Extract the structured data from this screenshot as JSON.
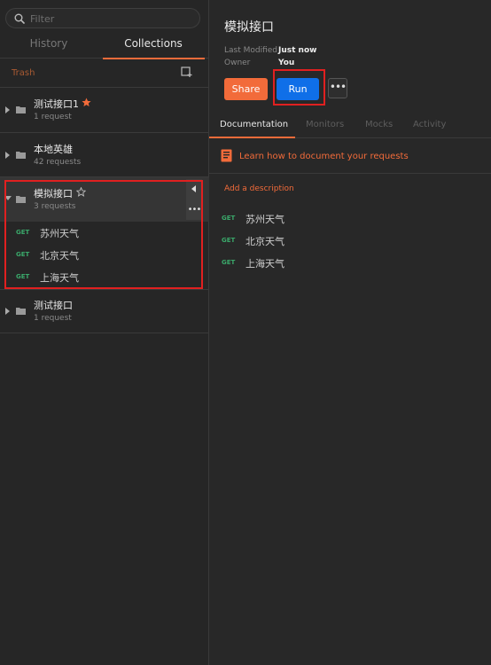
{
  "sidebar": {
    "filter_placeholder": "Filter",
    "tabs": [
      {
        "label": "History"
      },
      {
        "label": "Collections"
      }
    ],
    "trash_label": "Trash",
    "collections": [
      {
        "name": "测试接口1",
        "count": "1 request",
        "starred": true
      },
      {
        "name": "本地英雄",
        "count": "42 requests",
        "starred": false
      },
      {
        "name": "模拟接口",
        "count": "3 requests",
        "starred": false,
        "requests": [
          {
            "method": "GET",
            "name": "苏州天气"
          },
          {
            "method": "GET",
            "name": "北京天气"
          },
          {
            "method": "GET",
            "name": "上海天气"
          }
        ]
      },
      {
        "name": "测试接口",
        "count": "1 request",
        "starred": false
      }
    ]
  },
  "detail": {
    "title": "模拟接口",
    "last_modified_label": "Last Modified",
    "last_modified_value": "Just now",
    "owner_label": "Owner",
    "owner_value": "You",
    "share_label": "Share",
    "run_label": "Run",
    "more_label": "•••",
    "tabs": [
      {
        "label": "Documentation"
      },
      {
        "label": "Monitors"
      },
      {
        "label": "Mocks"
      },
      {
        "label": "Activity"
      }
    ],
    "learn_link": "Learn how to document your requests",
    "add_description": "Add a description",
    "requests": [
      {
        "method": "GET",
        "name": "苏州天气"
      },
      {
        "method": "GET",
        "name": "北京天气"
      },
      {
        "method": "GET",
        "name": "上海天气"
      }
    ]
  },
  "colors": {
    "accent": "#f26b3a",
    "run_blue": "#0f6fe8",
    "get_green": "#3aa86a",
    "highlight_red": "#e02020"
  }
}
